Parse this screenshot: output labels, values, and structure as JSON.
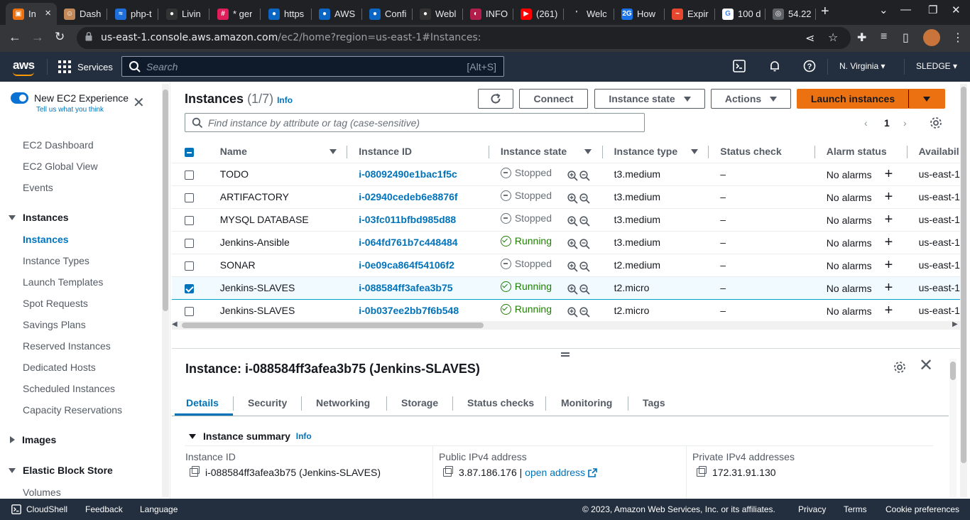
{
  "browser": {
    "tabs": [
      {
        "label": "In",
        "fav_color": "#ec7211",
        "fav_glyph": "▣",
        "active": true
      },
      {
        "label": "Dash",
        "fav_color": "#c2895a",
        "fav_glyph": "☺",
        "active": false
      },
      {
        "label": "php-t",
        "fav_color": "#1e6fd9",
        "fav_glyph": "≈",
        "active": false
      },
      {
        "label": "Livin",
        "fav_color": "#333",
        "fav_glyph": "●",
        "active": false
      },
      {
        "label": "* ger",
        "fav_color": "#e01e5a",
        "fav_glyph": "#",
        "active": false
      },
      {
        "label": "https",
        "fav_color": "#0a66c2",
        "fav_glyph": "●",
        "active": false
      },
      {
        "label": "AWS",
        "fav_color": "#0a66c2",
        "fav_glyph": "●",
        "active": false
      },
      {
        "label": "Confi",
        "fav_color": "#0a66c2",
        "fav_glyph": "●",
        "active": false
      },
      {
        "label": "Webl",
        "fav_color": "#333",
        "fav_glyph": "●",
        "active": false
      },
      {
        "label": "INFO",
        "fav_color": "#b21e4b",
        "fav_glyph": "◐",
        "active": false
      },
      {
        "label": "(261)",
        "fav_color": "#ff0000",
        "fav_glyph": "▶",
        "active": false
      },
      {
        "label": "Welc",
        "fav_color": "#202124",
        "fav_glyph": "'",
        "active": false
      },
      {
        "label": "How",
        "fav_color": "#1a73e8",
        "fav_glyph": "2G",
        "active": false
      },
      {
        "label": "Expir",
        "fav_color": "#e8472f",
        "fav_glyph": "~",
        "active": false
      },
      {
        "label": "100 d",
        "fav_color": "#ffffff",
        "fav_glyph": "G",
        "active": false
      },
      {
        "label": "54.22",
        "fav_color": "#5f6368",
        "fav_glyph": "◎",
        "active": false
      }
    ],
    "url_host": "us-east-1.console.aws.amazon.com",
    "url_path": "/ec2/home?region=us-east-1#Instances:"
  },
  "awsnav": {
    "logo": "aws",
    "services_label": "Services",
    "search_placeholder": "Search",
    "search_shortcut": "[Alt+S]",
    "region": "N. Virginia",
    "account": "SLEDGE"
  },
  "sidebar": {
    "new_experience": "New EC2 Experience",
    "tell_us": "Tell us what you think",
    "top_items": [
      "EC2 Dashboard",
      "EC2 Global View",
      "Events"
    ],
    "instances_section": "Instances",
    "instances_items": [
      "Instances",
      "Instance Types",
      "Launch Templates",
      "Spot Requests",
      "Savings Plans",
      "Reserved Instances",
      "Dedicated Hosts",
      "Scheduled Instances",
      "Capacity Reservations"
    ],
    "images_section": "Images",
    "ebs_section": "Elastic Block Store",
    "ebs_items": [
      "Volumes"
    ]
  },
  "main": {
    "title": "Instances",
    "count": "(1/7)",
    "info": "Info",
    "buttons": {
      "connect": "Connect",
      "instance_state": "Instance state",
      "actions": "Actions",
      "launch": "Launch instances"
    },
    "filter_placeholder": "Find instance by attribute or tag (case-sensitive)",
    "page": "1",
    "columns": [
      "Name",
      "Instance ID",
      "Instance state",
      "Instance type",
      "Status check",
      "Alarm status",
      "Availabil"
    ],
    "rows": [
      {
        "name": "TODO",
        "id": "i-08092490e1bac1f5c",
        "state": "Stopped",
        "type": "t3.medium",
        "check": "–",
        "alarm": "No alarms",
        "az": "us-east-1",
        "selected": false
      },
      {
        "name": "ARTIFACTORY",
        "id": "i-02940cedeb6e8876f",
        "state": "Stopped",
        "type": "t3.medium",
        "check": "–",
        "alarm": "No alarms",
        "az": "us-east-1",
        "selected": false
      },
      {
        "name": "MYSQL DATABASE",
        "id": "i-03fc011bfbd985d88",
        "state": "Stopped",
        "type": "t3.medium",
        "check": "–",
        "alarm": "No alarms",
        "az": "us-east-1",
        "selected": false
      },
      {
        "name": "Jenkins-Ansible",
        "id": "i-064fd761b7c448484",
        "state": "Running",
        "type": "t3.medium",
        "check": "–",
        "alarm": "No alarms",
        "az": "us-east-1",
        "selected": false
      },
      {
        "name": "SONAR",
        "id": "i-0e09ca864f54106f2",
        "state": "Stopped",
        "type": "t2.medium",
        "check": "–",
        "alarm": "No alarms",
        "az": "us-east-1",
        "selected": false
      },
      {
        "name": "Jenkins-SLAVES",
        "id": "i-088584ff3afea3b75",
        "state": "Running",
        "type": "t2.micro",
        "check": "–",
        "alarm": "No alarms",
        "az": "us-east-1",
        "selected": true
      },
      {
        "name": "Jenkins-SLAVES",
        "id": "i-0b037ee2bb7f6b548",
        "state": "Running",
        "type": "t2.micro",
        "check": "–",
        "alarm": "No alarms",
        "az": "us-east-1",
        "selected": false
      }
    ]
  },
  "details": {
    "title": "Instance: i-088584ff3afea3b75 (Jenkins-SLAVES)",
    "tabs": [
      "Details",
      "Security",
      "Networking",
      "Storage",
      "Status checks",
      "Monitoring",
      "Tags"
    ],
    "summary": "Instance summary",
    "info": "Info",
    "fields": [
      {
        "label": "Instance ID",
        "value": "i-088584ff3afea3b75 (Jenkins-SLAVES)"
      },
      {
        "label": "Public IPv4 address",
        "value": "3.87.186.176 | ",
        "link": "open address"
      },
      {
        "label": "Private IPv4 addresses",
        "value": "172.31.91.130"
      }
    ]
  },
  "footer": {
    "cloudshell": "CloudShell",
    "feedback": "Feedback",
    "language": "Language",
    "copyright": "© 2023, Amazon Web Services, Inc. or its affiliates.",
    "privacy": "Privacy",
    "terms": "Terms",
    "cookies": "Cookie preferences"
  }
}
